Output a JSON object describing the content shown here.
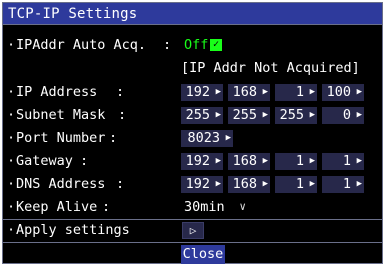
{
  "window": {
    "title": "TCP-IP Settings"
  },
  "bullet": "·",
  "rows": {
    "auto_acq": {
      "label": "IPAddr Auto Acq.",
      "value": "Off",
      "check": "✓"
    },
    "status": {
      "text": "[IP Addr Not Acquired]"
    },
    "ip_address": {
      "label": "IP Address",
      "octets": [
        "192",
        "168",
        "1",
        "100"
      ]
    },
    "subnet_mask": {
      "label": "Subnet Mask",
      "octets": [
        "255",
        "255",
        "255",
        "0"
      ]
    },
    "port_number": {
      "label": "Port Number",
      "value": "8023"
    },
    "gateway": {
      "label": "Gateway",
      "octets": [
        "192",
        "168",
        "1",
        "1"
      ]
    },
    "dns_address": {
      "label": "DNS Address",
      "octets": [
        "192",
        "168",
        "1",
        "1"
      ]
    },
    "keep_alive": {
      "label": "Keep Alive",
      "value": "30min",
      "caret": "∨"
    },
    "apply": {
      "label": "Apply settings",
      "button": "▷"
    }
  },
  "colon": ":",
  "arrow": "▶",
  "footer": {
    "close_label": "Close"
  },
  "colors": {
    "title_bar": "#2e3a9c",
    "cell_bg": "#27284a",
    "toggle_green": "#19ff19",
    "background": "#000000",
    "border": "#6a6f8a"
  }
}
